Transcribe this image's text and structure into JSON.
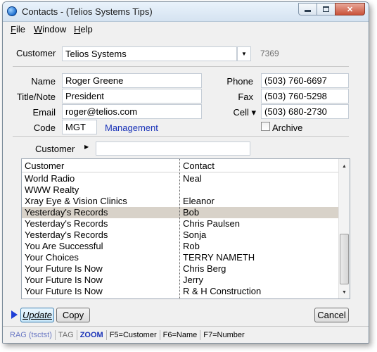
{
  "window": {
    "title": "Contacts - (Telios Systems Tips)"
  },
  "menu": [
    "File",
    "Window",
    "Help"
  ],
  "customer": {
    "label": "Customer",
    "value": "Telios Systems",
    "id": "7369"
  },
  "form": {
    "name_label": "Name",
    "name_value": "Roger Greene",
    "title_label": "Title/Note",
    "title_value": "President",
    "email_label": "Email",
    "email_value": "roger@telios.com",
    "code_label": "Code",
    "code_value": "MGT",
    "code_desc": "Management",
    "phone_label": "Phone",
    "phone_value": "(503) 760-6697",
    "fax_label": "Fax",
    "fax_value": "(503) 760-5298",
    "cell_label": "Cell ▾",
    "cell_value": "(503) 680-2730",
    "archive_label": "Archive",
    "archive_checked": false
  },
  "filter": {
    "label": "Customer",
    "value": ""
  },
  "grid": {
    "columns": [
      "Customer",
      "Contact"
    ],
    "rows": [
      {
        "customer": "World Radio",
        "contact": "Neal"
      },
      {
        "customer": "WWW Realty",
        "contact": ""
      },
      {
        "customer": "Xray Eye & Vision Clinics",
        "contact": "Eleanor"
      },
      {
        "customer": "Yesterday's Records",
        "contact": "Bob"
      },
      {
        "customer": "Yesterday's Records",
        "contact": "Chris Paulsen"
      },
      {
        "customer": "Yesterday's Records",
        "contact": "Sonja"
      },
      {
        "customer": "You Are Successful",
        "contact": "Rob"
      },
      {
        "customer": "Your Choices",
        "contact": "TERRY NAMETH"
      },
      {
        "customer": "Your Future Is Now",
        "contact": "Chris Berg"
      },
      {
        "customer": "Your Future Is Now",
        "contact": "Jerry"
      },
      {
        "customer": "Your Future Is Now",
        "contact": "R & H Construction"
      }
    ],
    "selected_index": 3
  },
  "buttons": {
    "update": "Update",
    "copy": "Copy",
    "cancel": "Cancel"
  },
  "status": {
    "rag": "RAG (tsctst)",
    "tag": "TAG",
    "zoom": "ZOOM",
    "f5": "F5=Customer",
    "f6": "F6=Name",
    "f7": "F7=Number"
  },
  "colors": {
    "accent_blue": "#1a33b8",
    "selection": "#d8d2c9",
    "close_red": "#c9523a"
  }
}
